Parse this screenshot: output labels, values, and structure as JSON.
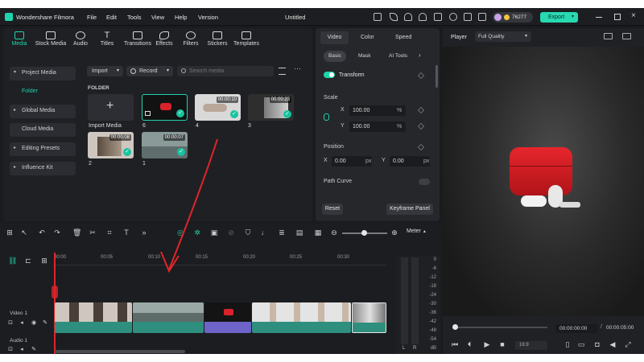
{
  "app": {
    "name": "Wondershare Filmora",
    "menu": [
      "File",
      "Edit",
      "Tools",
      "View",
      "Help",
      "Version"
    ],
    "project_title": "Untitled",
    "credits": "76277",
    "export_label": "Export"
  },
  "toolbar": {
    "tabs": [
      "Media",
      "Stock Media",
      "Audio",
      "Titles",
      "Transitions",
      "Effects",
      "Filters",
      "Stickers",
      "Templates"
    ],
    "active_tab": "Media"
  },
  "sidebar": {
    "items": [
      "Project Media",
      "Folder",
      "Global Media",
      "Cloud Media",
      "Editing Presets",
      "Influence Kit"
    ]
  },
  "media": {
    "import_label": "Import",
    "record_label": "Record",
    "search_placeholder": "Search media",
    "folder_header": "FOLDER",
    "import_tile_label": "Import Media",
    "clips": [
      {
        "label": "6",
        "duration": ""
      },
      {
        "label": "4",
        "duration": "00:00:10"
      },
      {
        "label": "3",
        "duration": "00:00:23"
      },
      {
        "label": "2",
        "duration": "00:00:08"
      },
      {
        "label": "1",
        "duration": "00:00:07"
      }
    ]
  },
  "properties": {
    "tabs": [
      "Video",
      "Color",
      "Speed"
    ],
    "subtabs": [
      "Basic",
      "Mask",
      "AI Tools"
    ],
    "transform_label": "Transform",
    "scale_label": "Scale",
    "scale_x": "100.00",
    "scale_y": "100.00",
    "percent_unit": "%",
    "position_label": "Position",
    "pos_x": "0.00",
    "pos_y": "0.00",
    "px_unit": "px",
    "x_label": "X",
    "y_label": "Y",
    "path_curve_label": "Path Curve",
    "reset_label": "Reset",
    "keyframe_label": "Keyframe Panel"
  },
  "player": {
    "label": "Player",
    "quality": "Full Quality",
    "current_time": "00:00:00:00",
    "total_time": "00:00:05:00",
    "aspect": "16:9"
  },
  "timeline": {
    "meter_label": "Meter",
    "ruler": [
      "00:00",
      "00:05",
      "00:10",
      "00:15",
      "00:20",
      "00:25",
      "00:30"
    ],
    "tracks": {
      "video": "Video 1",
      "audio": "Audio 1"
    },
    "db_scale": [
      "0",
      "-6",
      "-12",
      "-18",
      "-24",
      "-30",
      "-36",
      "-42",
      "-48",
      "-54",
      "dB"
    ],
    "channels": [
      "L",
      "R"
    ]
  },
  "colors": {
    "accent": "#1fd4ac",
    "export": "#27d9b1",
    "clip_teal": "#2f8f7e",
    "clip_purple": "#6e63c8",
    "annotation_arrow": "#e0252a"
  }
}
